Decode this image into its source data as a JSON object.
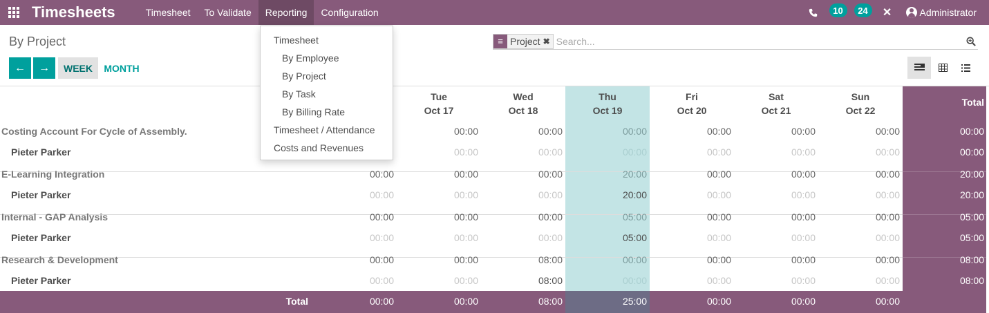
{
  "navbar": {
    "brand": "Timesheets",
    "menu": [
      "Timesheet",
      "To Validate",
      "Reporting",
      "Configuration"
    ],
    "active_menu": "Reporting",
    "badge_messages": "10",
    "badge_activities": "24",
    "user": "Administrator"
  },
  "control_panel": {
    "breadcrumb": "By Project",
    "facet": "Project",
    "search_placeholder": "Search...",
    "prev_label": "←",
    "next_label": "→",
    "range_week": "WEEK",
    "range_month": "MONTH",
    "active_range": "WEEK",
    "active_view": "grid"
  },
  "reporting_menu": {
    "items": [
      {
        "label": "Timesheet",
        "level": 1
      },
      {
        "label": "By Employee",
        "level": 2
      },
      {
        "label": "By Project",
        "level": 2
      },
      {
        "label": "By Task",
        "level": 2
      },
      {
        "label": "By Billing Rate",
        "level": 2
      },
      {
        "label": "Timesheet / Attendance",
        "level": 1
      },
      {
        "label": "Costs and Revenues",
        "level": 1
      }
    ]
  },
  "grid": {
    "columns": [
      {
        "day": "Tue",
        "date": "Oct 17"
      },
      {
        "day": "Wed",
        "date": "Oct 18"
      },
      {
        "day": "Thu",
        "date": "Oct 19"
      },
      {
        "day": "Fri",
        "date": "Oct 20"
      },
      {
        "day": "Sat",
        "date": "Oct 21"
      },
      {
        "day": "Sun",
        "date": "Oct 22"
      }
    ],
    "highlight_column": "Thu",
    "total_header": "Total",
    "rows": [
      {
        "label": "Costing Account For Cycle of Assembly.",
        "type": "project",
        "values": [
          "",
          "00:00",
          "00:00",
          "00:00",
          "00:00",
          "00:00",
          "00:00"
        ],
        "total": "00:00"
      },
      {
        "label": "Pieter Parker",
        "type": "employee",
        "values": [
          "",
          "00:00",
          "00:00",
          "00:00",
          "00:00",
          "00:00",
          "00:00"
        ],
        "total": "00:00"
      },
      {
        "label": "E-Learning Integration",
        "type": "project",
        "values": [
          "00:00",
          "00:00",
          "00:00",
          "20:00",
          "00:00",
          "00:00",
          "00:00"
        ],
        "total": "20:00"
      },
      {
        "label": "Pieter Parker",
        "type": "employee",
        "values": [
          "00:00",
          "00:00",
          "00:00",
          "20:00",
          "00:00",
          "00:00",
          "00:00"
        ],
        "total": "20:00"
      },
      {
        "label": "Internal - GAP Analysis",
        "type": "project",
        "values": [
          "00:00",
          "00:00",
          "00:00",
          "05:00",
          "00:00",
          "00:00",
          "00:00"
        ],
        "total": "05:00"
      },
      {
        "label": "Pieter Parker",
        "type": "employee",
        "values": [
          "00:00",
          "00:00",
          "00:00",
          "05:00",
          "00:00",
          "00:00",
          "00:00"
        ],
        "total": "05:00"
      },
      {
        "label": "Research & Development",
        "type": "project",
        "values": [
          "00:00",
          "00:00",
          "08:00",
          "00:00",
          "00:00",
          "00:00",
          "00:00"
        ],
        "total": "08:00"
      },
      {
        "label": "Pieter Parker",
        "type": "employee",
        "values": [
          "00:00",
          "00:00",
          "08:00",
          "00:00",
          "00:00",
          "00:00",
          "00:00"
        ],
        "total": "08:00"
      }
    ],
    "footer": {
      "label": "Total",
      "values": [
        "00:00",
        "00:00",
        "08:00",
        "25:00",
        "00:00",
        "00:00",
        "00:00"
      ]
    }
  },
  "colors": {
    "primary": "#875a7b",
    "accent": "#00a09d",
    "highlight": "#c3e4e5"
  }
}
